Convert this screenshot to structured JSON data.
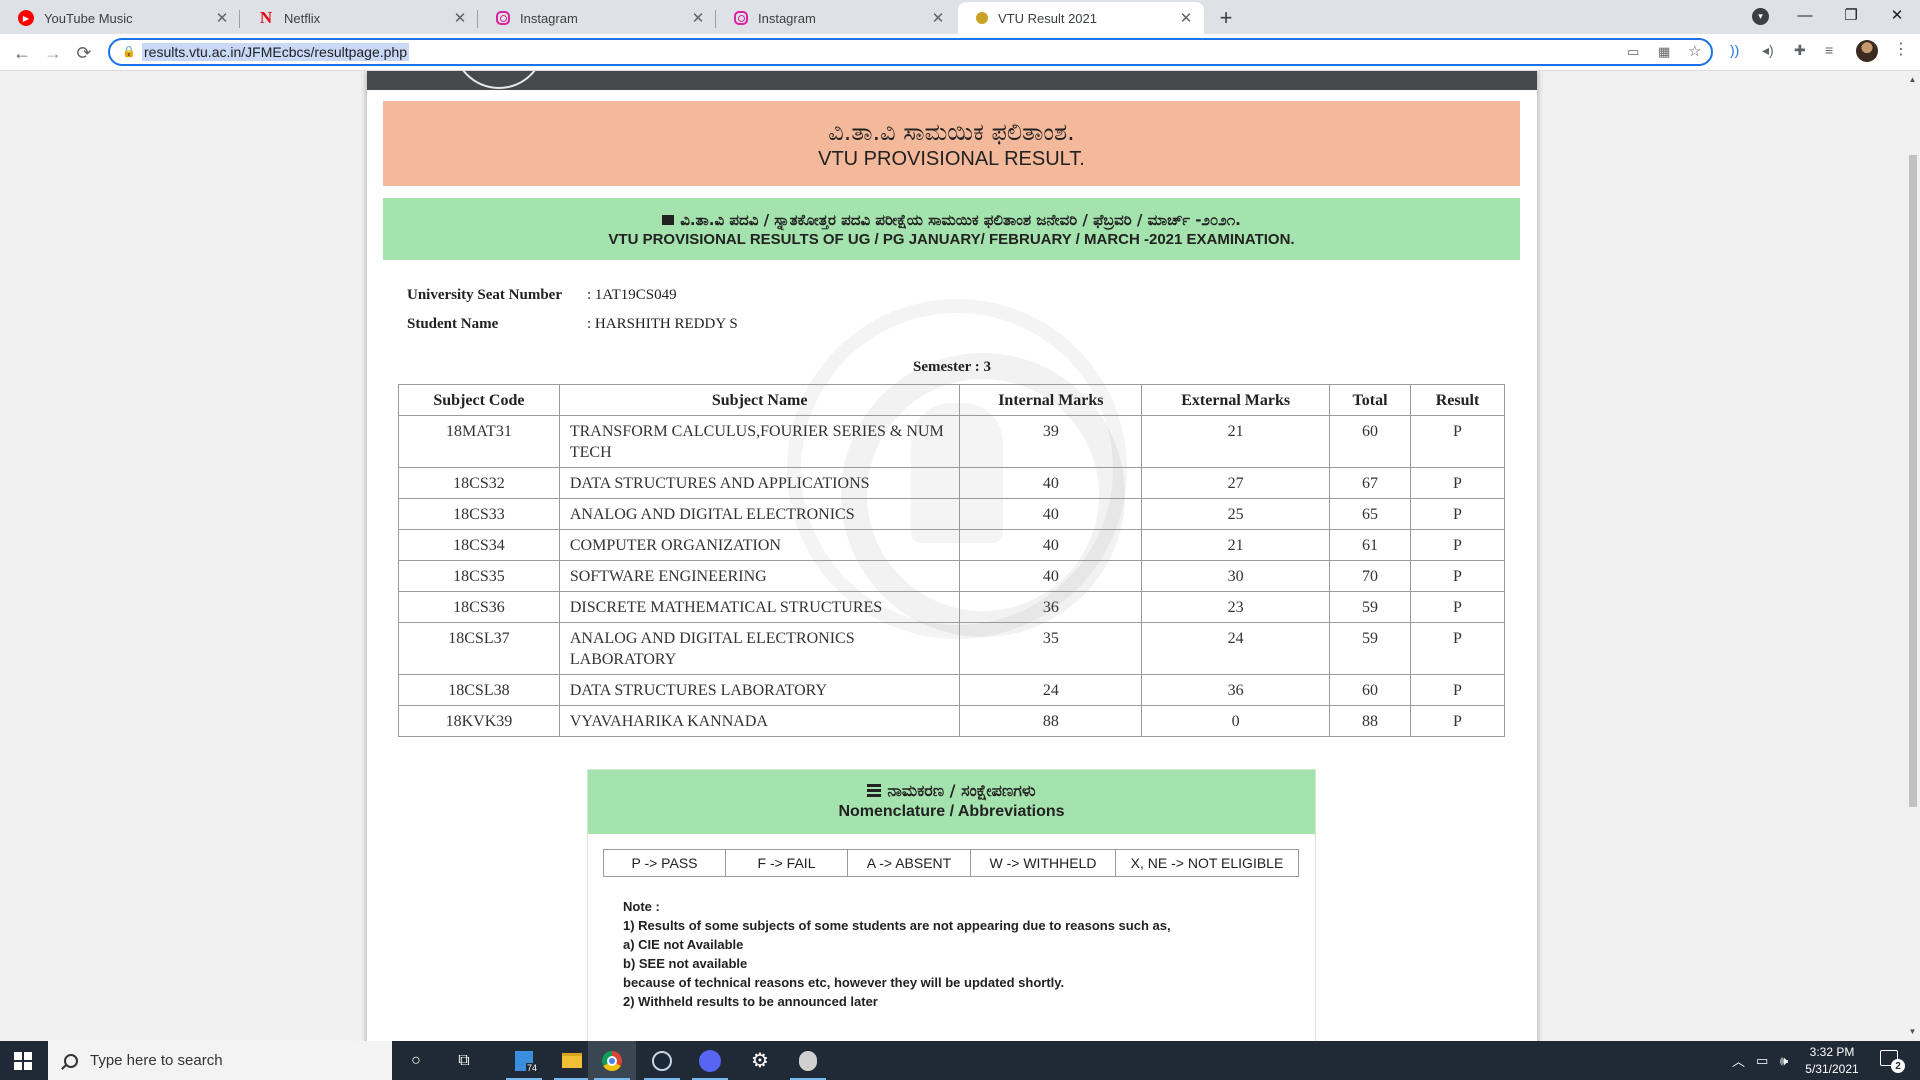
{
  "browser": {
    "tabs": [
      {
        "label": "YouTube Music",
        "icon": "youtube-music-icon"
      },
      {
        "label": "Netflix",
        "icon": "netflix-icon"
      },
      {
        "label": "Instagram",
        "icon": "instagram-icon"
      },
      {
        "label": "Instagram",
        "icon": "instagram-icon"
      },
      {
        "label": "VTU Result 2021",
        "icon": "vtu-icon",
        "active": true
      }
    ],
    "new_tab_glyph": "+",
    "close_glyph": "✕",
    "url": "results.vtu.ac.in/JFMEcbcs/resultpage.php"
  },
  "page": {
    "header_kn": "ವಿ.ತಾ.ವಿ ಸಾಮಯಿಕ ಫಲಿತಾಂಶ.",
    "header_en": "VTU PROVISIONAL RESULT.",
    "exam_kn": "ವಿ.ತಾ.ವಿ ಪದವಿ / ಸ್ನಾತಕೋತ್ತರ ಪದವಿ ಪರೀಕ್ಷೆಯ ಸಾಮಯಿಕ ಫಲಿತಾಂಶ ಜನೇವರಿ / ಫೆಬ್ರವರಿ / ಮಾರ್ಚ್ -೨೦೨೧.",
    "exam_en": "VTU PROVISIONAL RESULTS OF UG / PG JANUARY/ FEBRUARY / MARCH -2021 EXAMINATION.",
    "student": {
      "usn_label": "University Seat Number",
      "usn_value": ": 1AT19CS049",
      "name_label": "Student Name",
      "name_value": ": HARSHITH REDDY S"
    },
    "semester": "Semester : 3",
    "table": {
      "headers": [
        "Subject Code",
        "Subject Name",
        "Internal Marks",
        "External Marks",
        "Total",
        "Result"
      ],
      "rows": [
        [
          "18MAT31",
          "TRANSFORM CALCULUS,FOURIER SERIES & NUM TECH",
          "39",
          "21",
          "60",
          "P"
        ],
        [
          "18CS32",
          "DATA STRUCTURES AND APPLICATIONS",
          "40",
          "27",
          "67",
          "P"
        ],
        [
          "18CS33",
          "ANALOG AND DIGITAL ELECTRONICS",
          "40",
          "25",
          "65",
          "P"
        ],
        [
          "18CS34",
          "COMPUTER ORGANIZATION",
          "40",
          "21",
          "61",
          "P"
        ],
        [
          "18CS35",
          "SOFTWARE ENGINEERING",
          "40",
          "30",
          "70",
          "P"
        ],
        [
          "18CS36",
          "DISCRETE MATHEMATICAL STRUCTURES",
          "36",
          "23",
          "59",
          "P"
        ],
        [
          "18CSL37",
          "ANALOG AND DIGITAL ELECTRONICS LABORATORY",
          "35",
          "24",
          "59",
          "P"
        ],
        [
          "18CSL38",
          "DATA STRUCTURES LABORATORY",
          "24",
          "36",
          "60",
          "P"
        ],
        [
          "18KVK39",
          "VYAVAHARIKA KANNADA",
          "88",
          "0",
          "88",
          "P"
        ]
      ]
    },
    "nomenclature": {
      "title_kn": "ನಾಮಕರಣ / ಸಂಕ್ಷೇಪಣಗಳು",
      "title_en": "Nomenclature / Abbreviations",
      "items": [
        "P -> PASS",
        "F -> FAIL",
        "A -> ABSENT",
        "W -> WITHHELD",
        "X, NE -> NOT ELIGIBLE"
      ],
      "notes": [
        "Note :",
        "1) Results of some subjects of some students are not appearing due to reasons such as,",
        "a) CIE not Available",
        "b) SEE not available",
        "because of technical reasons etc, however they will be updated shortly.",
        "2) Withheld results to be announced later"
      ]
    }
  },
  "taskbar": {
    "search_placeholder": "Type here to search",
    "file_explorer_badge": "74",
    "time": "3:32 PM",
    "date": "5/31/2021",
    "notification_count": "2"
  },
  "colors": {
    "orange_header": "#f4b99a",
    "green_header": "#a5e3ae",
    "omnibox_focus": "#1a73e8",
    "taskbar": "#1f2a36"
  }
}
